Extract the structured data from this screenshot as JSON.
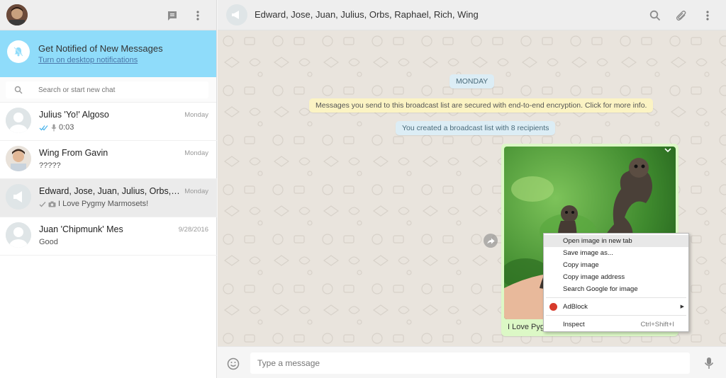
{
  "sidebar": {
    "notify_title": "Get Notified of New Messages",
    "notify_link": "Turn on desktop notifications",
    "search_placeholder": "Search or start new chat",
    "chats": [
      {
        "name": "Julius 'Yo!' Algoso",
        "time": "Monday",
        "preview": "0:03",
        "status": "double-tick",
        "icon": "mic-icon"
      },
      {
        "name": "Wing From Gavin",
        "time": "Monday",
        "preview": "?????"
      },
      {
        "name": "Edward, Jose, Juan, Julius, Orbs, Ra...",
        "time": "Monday",
        "preview": "I Love Pygmy Marmosets!",
        "status": "single-tick",
        "icon": "camera-icon",
        "active": true
      },
      {
        "name": "Juan 'Chipmunk' Mes",
        "time": "9/28/2016",
        "preview": "Good"
      }
    ]
  },
  "main": {
    "title": "Edward, Jose, Juan, Julius, Orbs, Raphael, Rich, Wing",
    "day_label": "MONDAY",
    "encryption_notice": "Messages you send to this broadcast list are secured with end-to-end encryption. Click for more info.",
    "created_notice": "You created a broadcast list with 8 recipients",
    "message_caption": "I Love Pygmy Marmosets!",
    "composer_placeholder": "Type a message"
  },
  "context_menu": {
    "items": [
      "Open image in new tab",
      "Save image as...",
      "Copy image",
      "Copy image address",
      "Search Google for image"
    ],
    "adblock": "AdBlock",
    "inspect": "Inspect",
    "inspect_shortcut": "Ctrl+Shift+I"
  },
  "colors": {
    "notify_banner": "#8fdcfa",
    "outgoing_bubble": "#dcf8c6",
    "chat_background": "#e9e4dd"
  }
}
